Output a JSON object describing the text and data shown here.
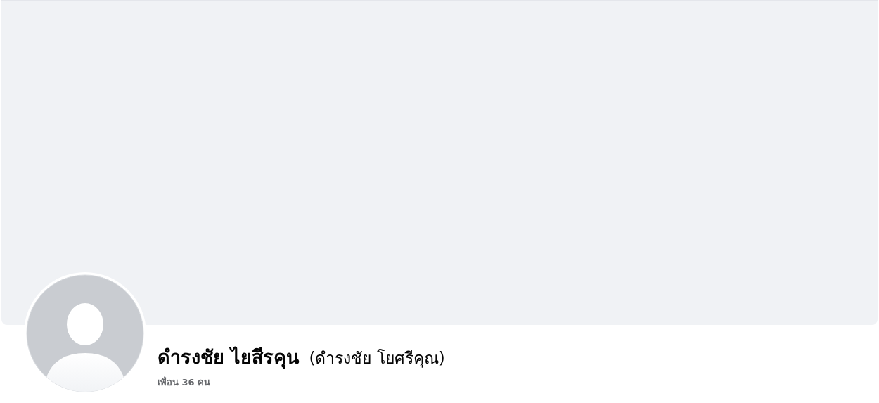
{
  "profile": {
    "avatar": {
      "kind": "default"
    },
    "name": "ดำรงชัย ไยสีรคุน",
    "alternate_name": "(ดำรงชัย โยศรีคุณ)",
    "friends": "เพื่อน 36 คน"
  }
}
